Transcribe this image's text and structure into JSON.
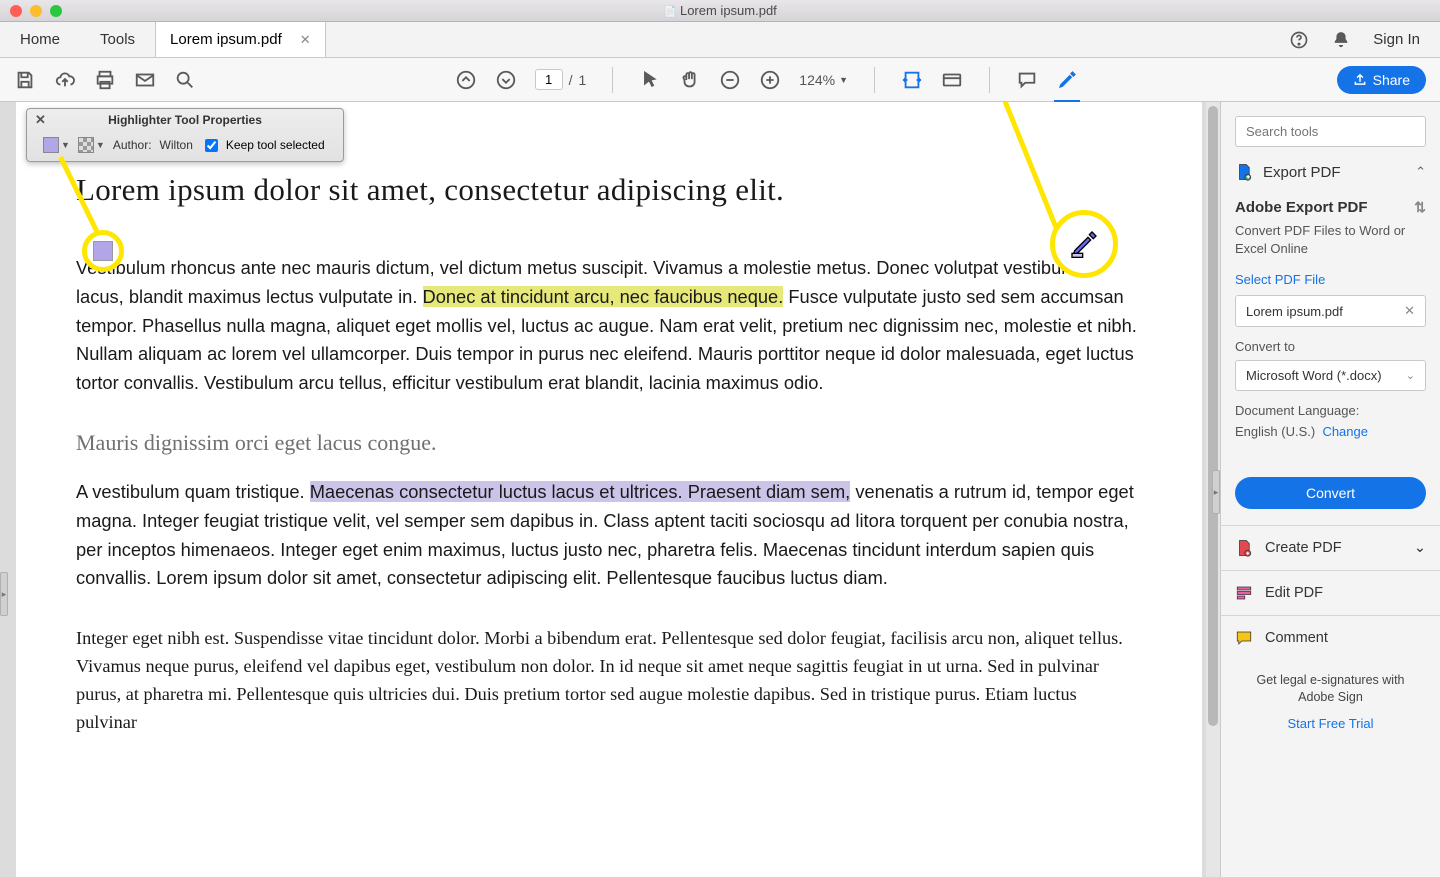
{
  "titlebar": {
    "title": "Lorem ipsum.pdf"
  },
  "tabs": {
    "home": "Home",
    "tools": "Tools",
    "doc": "Lorem ipsum.pdf",
    "signin": "Sign In"
  },
  "toolbar": {
    "page_current": "1",
    "page_total": "1",
    "page_sep": "/",
    "zoom": "124%",
    "share": "Share"
  },
  "props_panel": {
    "title": "Highlighter Tool Properties",
    "author_label": "Author:",
    "author_value": "Wilton",
    "keep_label": "Keep tool selected",
    "color": "#b3a6e8"
  },
  "document": {
    "h1": "Lorem ipsum dolor sit amet, consectetur adipiscing elit.",
    "p1a": "Vestibulum rhoncus ante nec mauris dictum, vel dictum metus suscipit. Vivamus a molestie metus. Donec volutpat vestibulum lacus, blandit maximus lectus vulputate in. ",
    "p1_hl": "Donec at tincidunt arcu, nec faucibus neque.",
    "p1b": " Fusce vulputate justo sed sem accumsan tempor. Phasellus nulla magna, aliquet eget mollis vel, luctus ac augue. Nam erat velit, pretium nec dignissim nec, molestie et nibh. Nullam aliquam ac lorem vel ullamcorper. Duis tempor in purus nec eleifend. Mauris porttitor neque id dolor malesuada, eget luctus tortor convallis. Vestibulum arcu tellus, efficitur vestibulum erat blandit, lacinia maximus odio.",
    "h2": "Mauris dignissim orci eget lacus congue.",
    "p2a": "A vestibulum quam tristique. ",
    "p2_hl": "Maecenas consectetur luctus lacus et ultrices. Praesent diam sem,",
    "p2b": " venenatis a rutrum id, tempor eget magna. Integer feugiat tristique velit, vel semper sem dapibus in. Class aptent taciti sociosqu ad litora torquent per conubia nostra, per inceptos himenaeos. Integer eget enim maximus, luctus justo nec, pharetra felis. Maecenas tincidunt interdum sapien quis convallis. Lorem ipsum dolor sit amet, consectetur adipiscing elit. Pellentesque faucibus luctus diam.",
    "p3": "Integer eget nibh est. Suspendisse vitae tincidunt dolor. Morbi a bibendum erat. Pellentesque sed dolor feugiat, facilisis arcu non, aliquet tellus. Vivamus neque purus, eleifend vel dapibus eget, vestibulum non dolor. In id neque sit amet neque sagittis feugiat in ut urna. Sed in pulvinar purus, at pharetra mi. Pellentesque quis ultricies dui. Duis pretium tortor sed augue molestie dapibus. Sed in tristique purus. Etiam luctus pulvinar"
  },
  "right": {
    "search_placeholder": "Search tools",
    "export_pdf": "Export PDF",
    "export_title": "Adobe Export PDF",
    "export_sub": "Convert PDF Files to Word or Excel Online",
    "select_file": "Select PDF File",
    "filename": "Lorem ipsum.pdf",
    "convert_to": "Convert to",
    "format": "Microsoft Word (*.docx)",
    "doclang_label": "Document Language:",
    "doclang_value": "English (U.S.)",
    "change": "Change",
    "convert_btn": "Convert",
    "create_pdf": "Create PDF",
    "edit_pdf": "Edit PDF",
    "comment": "Comment",
    "promo": "Get legal e-signatures with Adobe Sign",
    "trial": "Start Free Trial"
  }
}
